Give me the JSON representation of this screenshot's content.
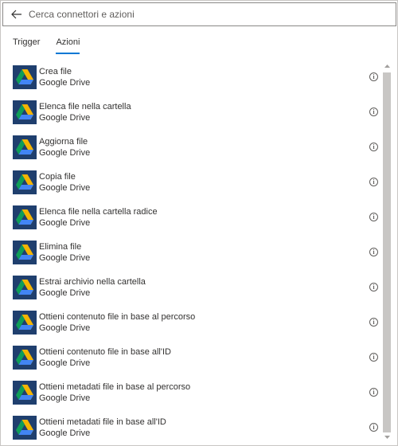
{
  "search": {
    "placeholder": "Cerca connettori e azioni"
  },
  "tabs": [
    {
      "label": "Trigger",
      "active": false
    },
    {
      "label": "Azioni",
      "active": true
    }
  ],
  "items": [
    {
      "title": "Crea file",
      "connector": "Google Drive"
    },
    {
      "title": "Elenca file nella cartella",
      "connector": "Google Drive"
    },
    {
      "title": "Aggiorna file",
      "connector": "Google Drive"
    },
    {
      "title": "Copia file",
      "connector": "Google Drive"
    },
    {
      "title": "Elenca file nella cartella radice",
      "connector": "Google Drive"
    },
    {
      "title": "Elimina file",
      "connector": "Google Drive"
    },
    {
      "title": "Estrai archivio nella cartella",
      "connector": "Google Drive"
    },
    {
      "title": "Ottieni contenuto file in base al percorso",
      "connector": "Google Drive"
    },
    {
      "title": "Ottieni contenuto file in base all'ID",
      "connector": "Google Drive"
    },
    {
      "title": "Ottieni metadati file in base al percorso",
      "connector": "Google Drive"
    },
    {
      "title": "Ottieni metadati file in base all'ID",
      "connector": "Google Drive"
    }
  ],
  "icons": {
    "back": "arrow-left-icon",
    "connector": "google-drive-icon",
    "info": "info-icon"
  },
  "colors": {
    "accent": "#0078d4",
    "logo_background": "#1f3f6e",
    "drive_green": "#0f9d58",
    "drive_yellow": "#f4b400",
    "drive_blue": "#4285f4"
  }
}
